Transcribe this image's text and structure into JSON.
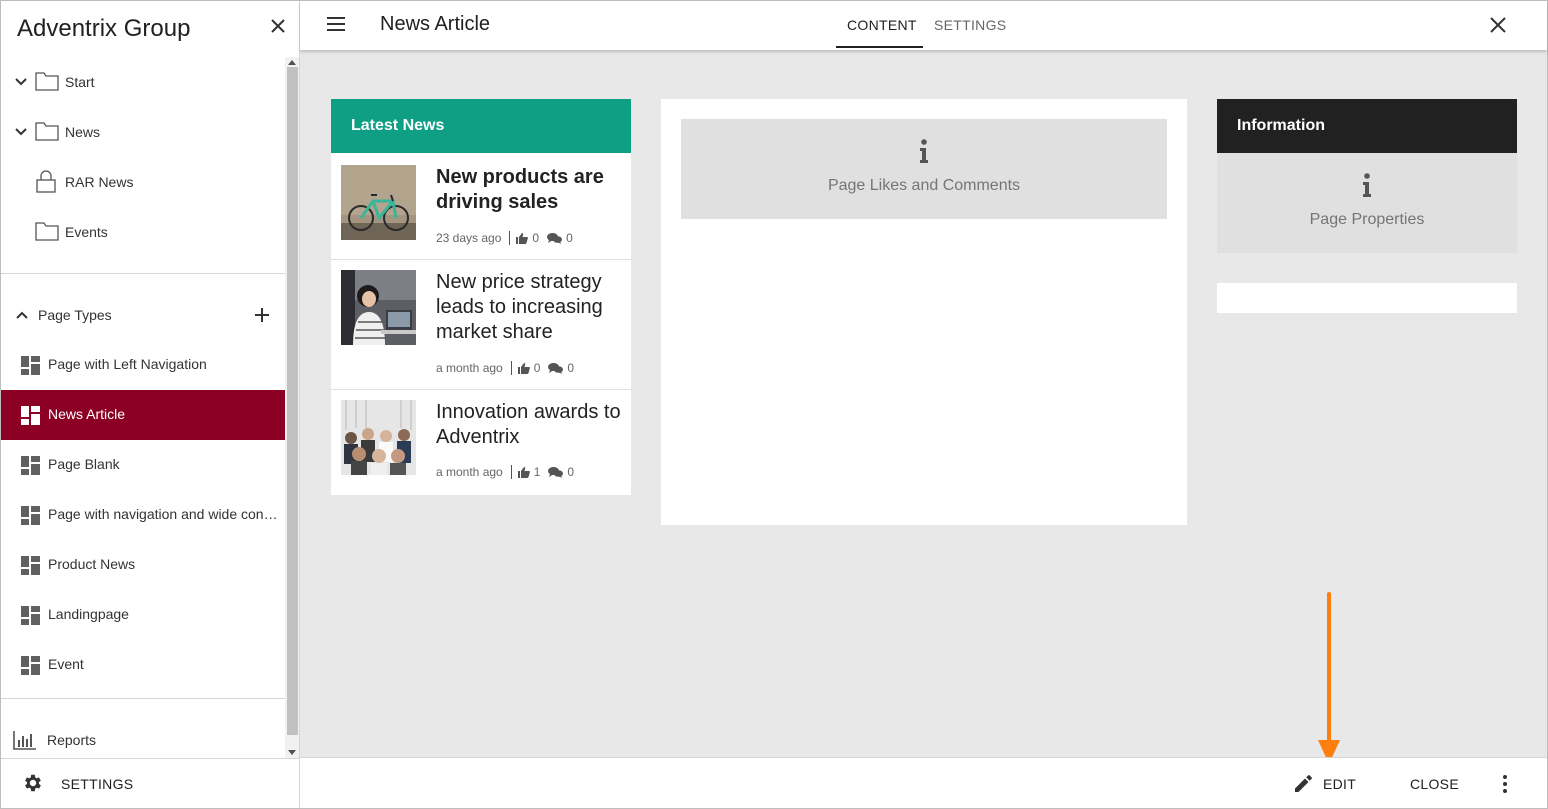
{
  "sidebar": {
    "title": "Adventrix Group",
    "tree": [
      {
        "label": "Start",
        "icon": "folder-icon",
        "expandable": true
      },
      {
        "label": "News",
        "icon": "folder-icon",
        "expandable": true
      },
      {
        "label": "RAR News",
        "icon": "lock-icon",
        "expandable": false
      },
      {
        "label": "Events",
        "icon": "folder-icon",
        "expandable": false
      }
    ],
    "page_types_label": "Page Types",
    "page_types": [
      {
        "label": "Page with Left Navigation",
        "active": false
      },
      {
        "label": "News Article",
        "active": true
      },
      {
        "label": "Page Blank",
        "active": false
      },
      {
        "label": "Page with navigation and wide content",
        "active": false
      },
      {
        "label": "Product News",
        "active": false
      },
      {
        "label": "Landingpage",
        "active": false
      },
      {
        "label": "Event",
        "active": false
      }
    ],
    "reports_label": "Reports",
    "settings_label": "SETTINGS"
  },
  "topbar": {
    "title": "News Article",
    "tabs": [
      {
        "label": "CONTENT",
        "selected": true
      },
      {
        "label": "SETTINGS",
        "selected": false
      }
    ]
  },
  "main": {
    "latest_news": {
      "title": "Latest News",
      "items": [
        {
          "title": "New products are driving sales",
          "time": "23 days ago",
          "likes": "0",
          "comments": "0",
          "image": "bicycle-photo"
        },
        {
          "title": "New price strategy leads to increasing market share",
          "time": "a month ago",
          "likes": "0",
          "comments": "0",
          "image": "woman-laptop-photo"
        },
        {
          "title": "Innovation awards to Adventrix",
          "time": "a month ago",
          "likes": "1",
          "comments": "0",
          "image": "audience-photo"
        }
      ]
    },
    "likes_placeholder": "Page Likes and Comments",
    "information": {
      "title": "Information",
      "placeholder": "Page Properties"
    }
  },
  "bottombar": {
    "edit_label": "EDIT",
    "close_label": "CLOSE"
  },
  "colors": {
    "active_item": "#8b0024",
    "latest_news_header": "#0e9f85",
    "information_header": "#212121",
    "annotation_arrow": "#ff7f0e"
  }
}
